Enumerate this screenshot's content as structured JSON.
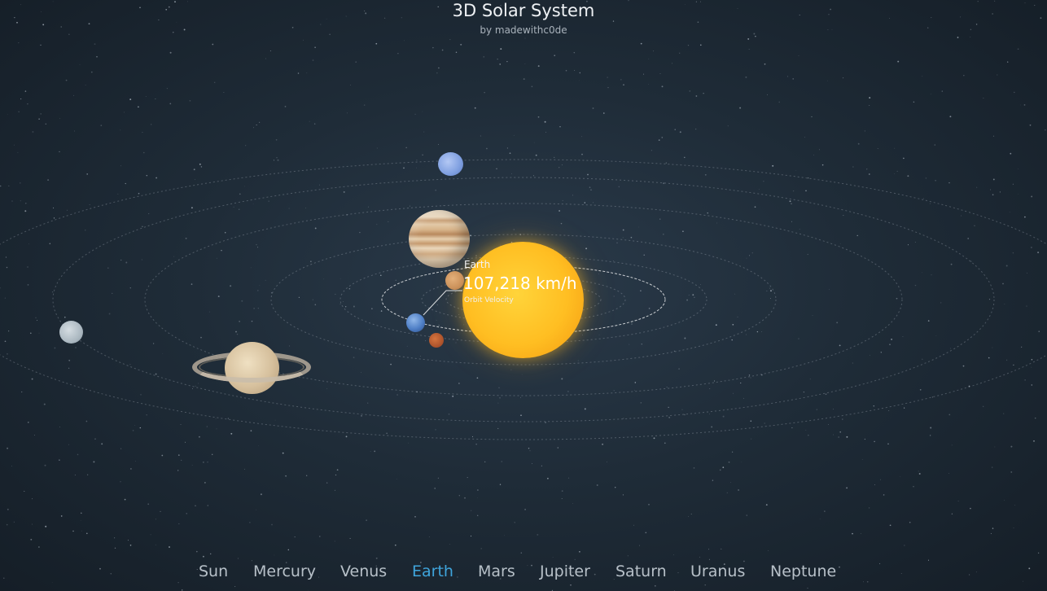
{
  "header": {
    "title": "3D Solar System",
    "subtitle": "by madewithc0de"
  },
  "callout": {
    "planet_name": "Earth",
    "value": "107,218 km/h",
    "caption": "Orbit Velocity"
  },
  "nav": {
    "items": [
      {
        "label": "Sun"
      },
      {
        "label": "Mercury"
      },
      {
        "label": "Venus"
      },
      {
        "label": "Earth"
      },
      {
        "label": "Mars"
      },
      {
        "label": "Jupiter"
      },
      {
        "label": "Saturn"
      },
      {
        "label": "Uranus"
      },
      {
        "label": "Neptune"
      }
    ],
    "active": "Earth"
  },
  "colors": {
    "background": "#1b2631",
    "nav_text": "#b7c0c8",
    "nav_active": "#3fa5dc",
    "sun": "#ffbe22"
  }
}
